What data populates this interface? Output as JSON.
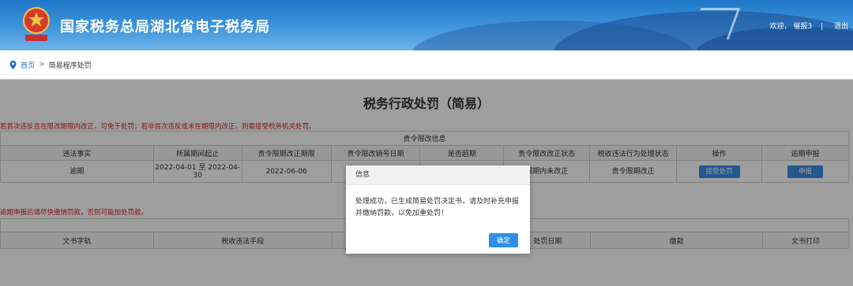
{
  "header": {
    "site_title": "国家税务总局湖北省电子税务局",
    "welcome": "欢迎，",
    "username": "催报3",
    "divider": "|",
    "logout": "退出"
  },
  "breadcrumb": {
    "home": "首页",
    "separator": ">",
    "current": "简易程序处罚"
  },
  "page": {
    "title": "税务行政处罚（简易）",
    "note_top": "若首次违反且在限改期限内改正，可免于处罚；若非首次违反或未在期限内改正，则需接受税务机关处罚。",
    "note_bottom": "逾期申报后请尽快缴纳罚款，否则可能加处罚款。"
  },
  "order_table": {
    "caption": "责令限改信息",
    "headers": [
      "违法事实",
      "所属期间起止",
      "责令限期改正期限",
      "责令限改销号日期",
      "是否超期",
      "责令限改改正状态",
      "税收违法行为处理状态",
      "操作",
      "逾期申报"
    ],
    "row": {
      "fact": "逾期",
      "period_line1": "2022-04-01 至 2022-04-",
      "period_line2": "30",
      "deadline": "2022-06-06",
      "cancel_date": "",
      "overdue": "",
      "correction_status": "限期内未改正",
      "handling_status": "责令限期改正",
      "action_button": "接受处罚",
      "declare_button": "申报"
    }
  },
  "penalty_table": {
    "headers": [
      "文书字轨",
      "税收违法手段",
      "",
      "处罚日期",
      "缴款",
      "文书打印"
    ]
  },
  "dialog": {
    "title": "信息",
    "message": "处理成功，已生成简易处罚决定书，请及时补充申报并缴纳罚款，以免加重处罚！",
    "confirm": "确定"
  },
  "colors": {
    "header_blue": "#2a7fd0",
    "link_blue": "#1f6fc0",
    "warning_red": "#d9251c",
    "button_blue": "#3a8ee6"
  }
}
